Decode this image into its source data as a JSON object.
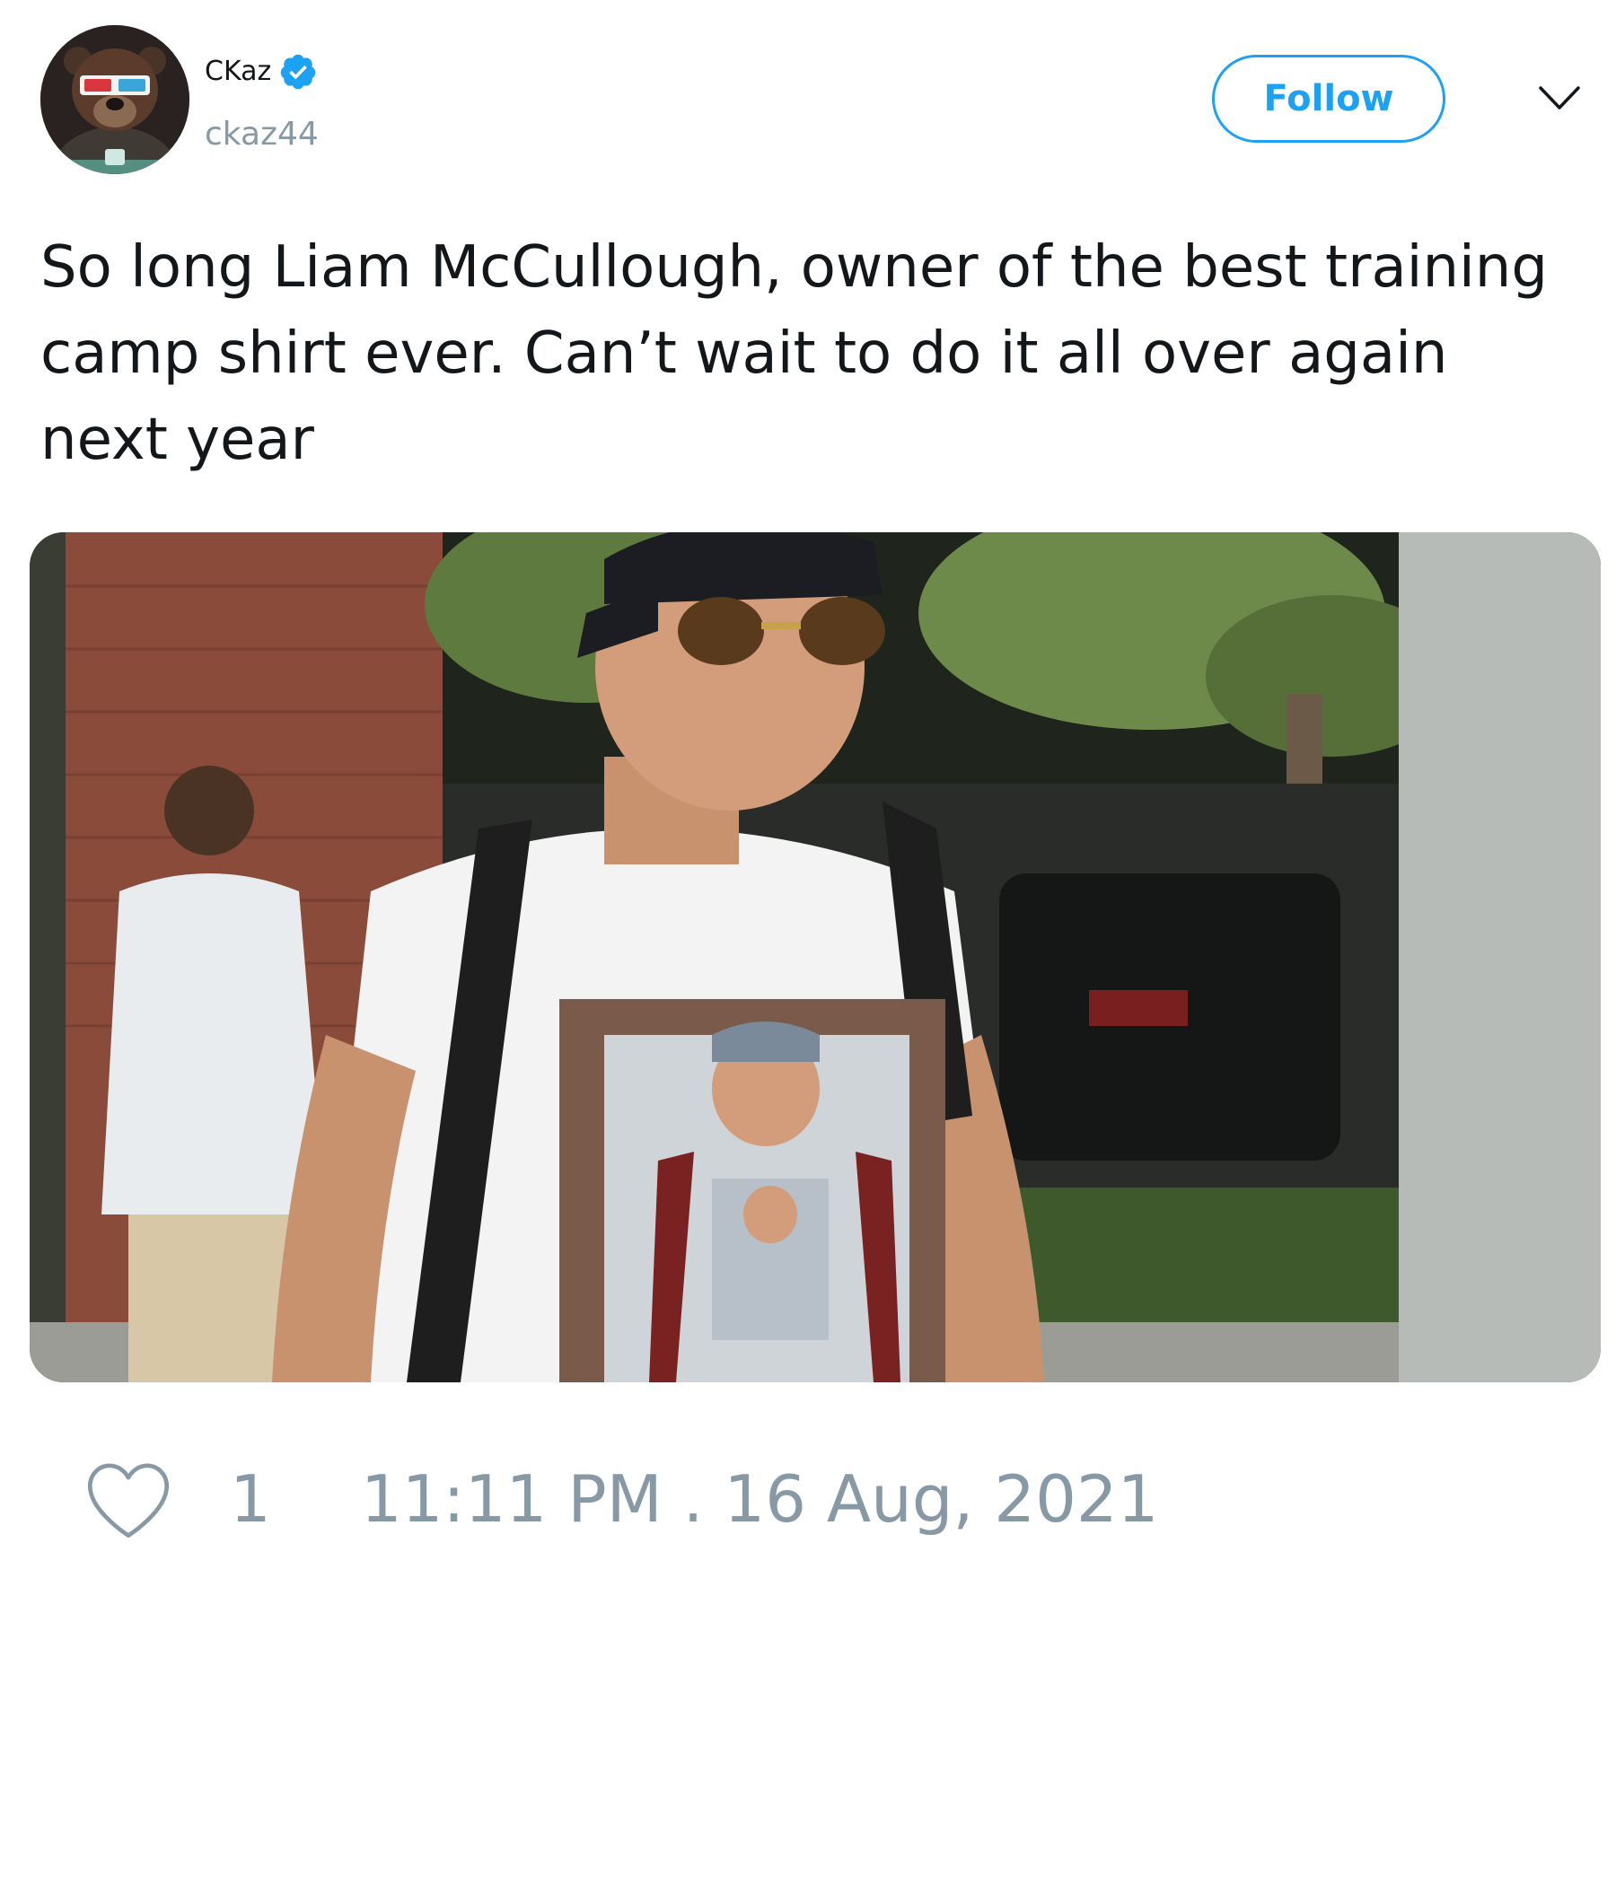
{
  "author": {
    "display_name": "CKaz",
    "handle": "ckaz44",
    "verified": true,
    "avatar_icon": "bear-with-3d-glasses-avatar"
  },
  "actions": {
    "follow_label": "Follow",
    "menu_icon": "chevron-down-icon"
  },
  "tweet": {
    "text": "So long Liam McCullough, owner of the best training camp shirt ever. Can’t wait to do it all over again next year",
    "media_description": "photo"
  },
  "footer": {
    "like_icon": "heart-outline-icon",
    "like_count": "1",
    "timestamp": "11:11 PM . 16 Aug, 2021"
  },
  "colors": {
    "accent": "#1da1f2",
    "text": "#14171a",
    "muted": "#8899a6",
    "background": "#ffffff"
  }
}
